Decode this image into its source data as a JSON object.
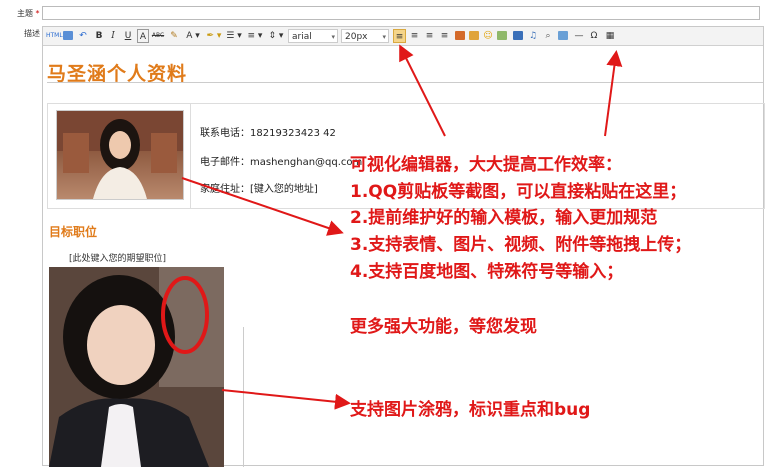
{
  "form": {
    "subject_label": "主题",
    "subject_required": "*",
    "desc_label": "描述"
  },
  "toolbar": {
    "html_label": "HTML",
    "bold": "B",
    "italic": "I",
    "underline": "U",
    "textcolor_a": "A",
    "strike": "ABC",
    "font_color_a": "A",
    "font_family": "arial",
    "font_size": "20px",
    "icons": [
      "source-icon",
      "preview-icon",
      "undo-icon",
      "bold-icon",
      "italic-icon",
      "underline-icon",
      "fontcolor-icon",
      "strikethrough-icon",
      "brush-icon",
      "forecolor-icon",
      "backcolor-icon",
      "ordered-list-icon",
      "unordered-list-icon",
      "lineheight-icon",
      "align-left-icon",
      "align-center-icon",
      "align-right-icon",
      "align-justify-icon",
      "image-icon",
      "media-icon",
      "emotion-icon",
      "map-icon",
      "video-icon",
      "music-icon",
      "attachment-icon",
      "template-icon",
      "hr-icon",
      "specialchars-icon",
      "table-icon"
    ]
  },
  "document": {
    "title": "马圣涵个人资料",
    "phone": "联系电话：18219323423 42",
    "email": "电子邮件：mashenghan@qq.com",
    "address": "家庭住址：[键入您的地址]",
    "section_title": "目标职位",
    "placeholder": "[此处键入您的期望职位]"
  },
  "annotations": {
    "headline": "可视化编辑器，大大提高工作效率：",
    "item1": "1.QQ剪贴板等截图，可以直接粘贴在这里；",
    "item2": "2.提前维护好的输入模板，输入更加规范",
    "item3": "3.支持表情、图片、视频、附件等拖拽上传；",
    "item4": "4.支持百度地图、特殊符号等输入；",
    "more": "更多强大功能，等您发现",
    "doodle": "支持图片涂鸦，标识重点和bug"
  },
  "colors": {
    "accent_orange": "#e07b1a",
    "annotation_red": "#e01818",
    "active_button": "#f5d58a"
  }
}
